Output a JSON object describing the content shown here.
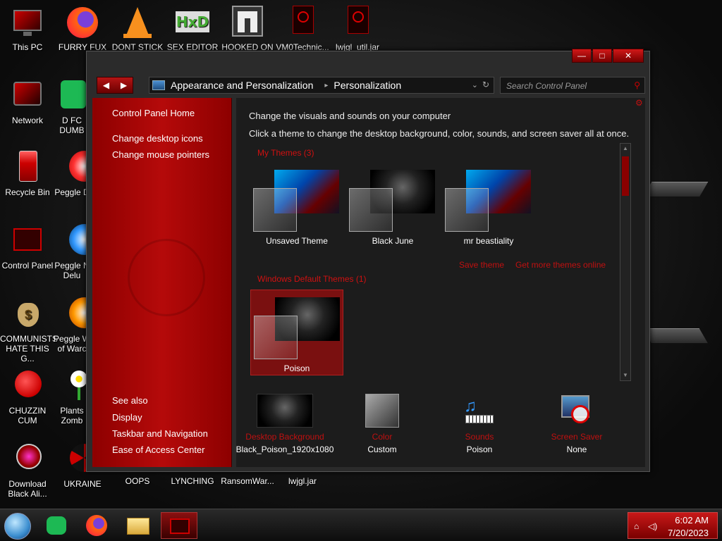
{
  "desktop_icons": [
    {
      "label": "This PC",
      "icon": "monitor-icon"
    },
    {
      "label": "FURRY FUX",
      "icon": "firefox-icon"
    },
    {
      "label": "DONT STICK",
      "icon": "vlc-cone-icon"
    },
    {
      "label": "SEX EDITOR",
      "icon": "hxd-icon"
    },
    {
      "label": "HOOKED ON",
      "icon": "maze-icon"
    },
    {
      "label": "VM0Technic...",
      "icon": "alien-file-icon"
    },
    {
      "label": "lwjgl_util.jar",
      "icon": "alien-file-icon"
    },
    {
      "label": "Network",
      "icon": "network-icon"
    },
    {
      "label": "D FC DUMB",
      "icon": "green-app-icon"
    },
    {
      "label": "Recycle Bin",
      "icon": "recycle-bin-icon"
    },
    {
      "label": "Peggle D",
      "icon": "peggle-icon"
    },
    {
      "label": "Control Panel",
      "icon": "control-panel-icon"
    },
    {
      "label": "Peggle N Delu",
      "icon": "peggle-icon"
    },
    {
      "label": "COMMUNISTS HATE THIS G...",
      "icon": "money-bag-icon"
    },
    {
      "label": "Peggle W of Warc",
      "icon": "peggle-icon"
    },
    {
      "label": "CHUZZIN CUM",
      "icon": "chuzzle-icon"
    },
    {
      "label": "Plants Zomb",
      "icon": "flower-icon"
    },
    {
      "label": "Download Black Ali...",
      "icon": "alien-download-icon"
    },
    {
      "label": "UKRAINE",
      "icon": "radiation-icon"
    },
    {
      "label": "OOPS",
      "icon": "blank-icon"
    },
    {
      "label": "LYNCHING",
      "icon": "blank-icon"
    },
    {
      "label": "RansomWar...",
      "icon": "blank-icon"
    },
    {
      "label": "lwjgl.jar",
      "icon": "blank-icon"
    }
  ],
  "window": {
    "controls": {
      "minimize": "—",
      "maximize": "□",
      "close": "✕"
    },
    "nav": {
      "back": "◀",
      "forward": "▶"
    },
    "breadcrumb": [
      "Appearance and Personalization",
      "Personalization"
    ],
    "search_placeholder": "Search Control Panel",
    "sidebar": {
      "home": "Control Panel Home",
      "links": [
        "Change desktop icons",
        "Change mouse pointers"
      ],
      "see_also_title": "See also",
      "see_also": [
        "Display",
        "Taskbar and Navigation",
        "Ease of Access Center"
      ]
    },
    "content": {
      "heading": "Change the visuals and sounds on your computer",
      "subheading": "Click a theme to change the desktop background, color, sounds, and screen saver all at once.",
      "my_themes_title": "My Themes (3)",
      "my_themes": [
        "Unsaved Theme",
        "Black June",
        "mr beastiality"
      ],
      "save_theme": "Save theme",
      "get_more": "Get more themes online",
      "default_themes_title": "Windows Default Themes (1)",
      "default_themes": [
        "Poison"
      ],
      "settings": [
        {
          "label": "Desktop Background",
          "value": "Black_Poison_1920x1080"
        },
        {
          "label": "Color",
          "value": "Custom"
        },
        {
          "label": "Sounds",
          "value": "Poison"
        },
        {
          "label": "Screen Saver",
          "value": "None"
        }
      ]
    }
  },
  "taskbar": {
    "time": "6:02 AM",
    "date": "7/20/2023"
  },
  "colors": {
    "accent": "#c01010",
    "sidebar": "#a00808",
    "window_bg": "#1c1c1c"
  }
}
